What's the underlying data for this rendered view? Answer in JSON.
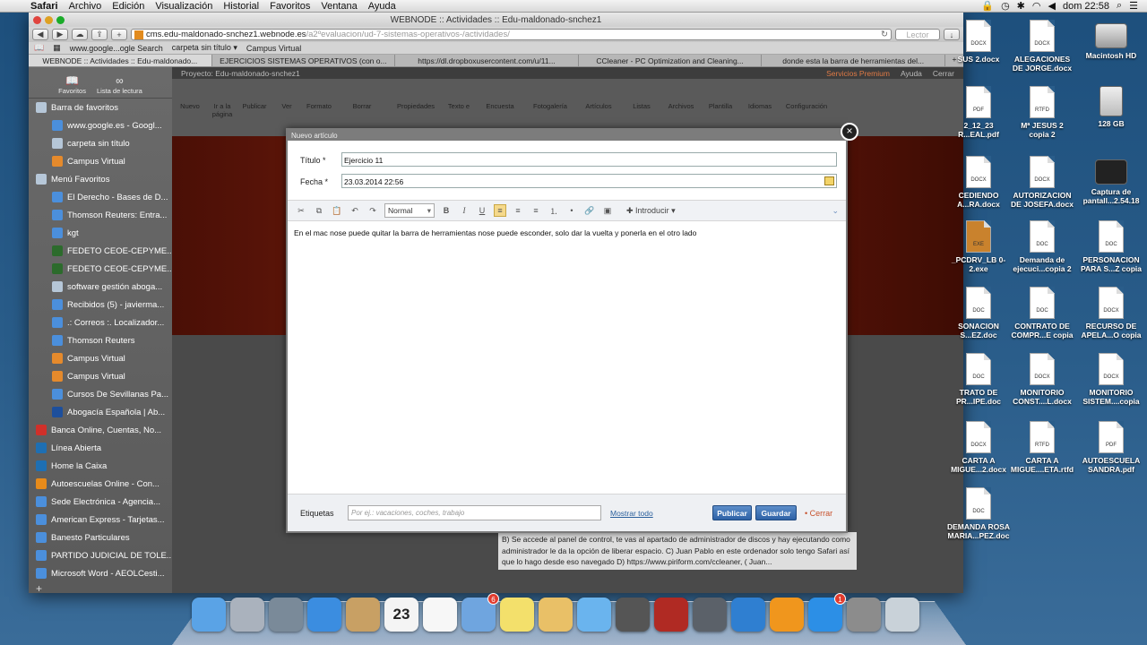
{
  "menubar": {
    "app": "Safari",
    "items": [
      "Archivo",
      "Edición",
      "Visualización",
      "Historial",
      "Favoritos",
      "Ventana",
      "Ayuda"
    ],
    "clock": "dom 22:58"
  },
  "window": {
    "title": "WEBNODE :: Actividades :: Edu-maldonado-snchez1",
    "address_domain": "cms.edu-maldonado-snchez1.webnode.es",
    "address_path": "/a2ºevaluacion/ud-7-sistemas-operativos-/actividades/",
    "reader_label": "Lector"
  },
  "bookmarks_bar": [
    "www.google...ogle Search",
    "carpeta sin título ▾",
    "Campus Virtual"
  ],
  "tabs": [
    "WEBNODE :: Actividades :: Edu-maldonado...",
    "EJERCICIOS SISTEMAS OPERATIVOS (con o...",
    "https://dl.dropboxusercontent.com/u/11...",
    "CCleaner - PC Optimization and Cleaning...",
    "donde esta la barra de herramientas del..."
  ],
  "sidebar": {
    "tab_favorites": "Favoritos",
    "tab_reading": "Lista de lectura",
    "items": [
      {
        "label": "Barra de favoritos",
        "indent": false,
        "icon": "folder-icon"
      },
      {
        "label": "www.google.es - Googl...",
        "indent": true,
        "icon": "globe-icon"
      },
      {
        "label": "carpeta sin título",
        "indent": true,
        "icon": "folder-icon"
      },
      {
        "label": "Campus Virtual",
        "indent": true,
        "icon": "campus-icon"
      },
      {
        "label": "Menú Favoritos",
        "indent": false,
        "icon": "folder-icon"
      },
      {
        "label": "El Derecho - Bases de D...",
        "indent": true,
        "icon": "globe-icon"
      },
      {
        "label": "Thomson Reuters: Entra...",
        "indent": true,
        "icon": "globe-icon"
      },
      {
        "label": "kgt",
        "indent": true,
        "icon": "globe-icon"
      },
      {
        "label": "FEDETO CEOE-CEPYME...",
        "indent": true,
        "icon": "fedeto-icon"
      },
      {
        "label": "FEDETO CEOE-CEPYME...",
        "indent": true,
        "icon": "fedeto-icon"
      },
      {
        "label": "software gestión aboga...",
        "indent": true,
        "icon": "folder-icon"
      },
      {
        "label": "Recibidos (5) - javierma...",
        "indent": true,
        "icon": "globe-icon"
      },
      {
        "label": ".: Correos :. Localizador...",
        "indent": true,
        "icon": "globe-icon"
      },
      {
        "label": "Thomson Reuters",
        "indent": true,
        "icon": "globe-icon"
      },
      {
        "label": "Campus Virtual",
        "indent": true,
        "icon": "campus-icon"
      },
      {
        "label": "Campus Virtual",
        "indent": true,
        "icon": "campus-icon"
      },
      {
        "label": "Cursos De Sevillanas Pa...",
        "indent": true,
        "icon": "globe-icon"
      },
      {
        "label": "Abogacía Española | Ab...",
        "indent": true,
        "icon": "abogacia-icon"
      },
      {
        "label": "Banca Online, Cuentas, No...",
        "indent": false,
        "icon": "bank-icon"
      },
      {
        "label": "Línea Abierta",
        "indent": false,
        "icon": "caixa-icon"
      },
      {
        "label": "Home  la Caixa",
        "indent": false,
        "icon": "caixa-icon"
      },
      {
        "label": "Autoescuelas Online - Con...",
        "indent": false,
        "icon": "autoescuela-icon"
      },
      {
        "label": "Sede Electrónica - Agencia...",
        "indent": false,
        "icon": "globe-icon"
      },
      {
        "label": "American Express - Tarjetas...",
        "indent": false,
        "icon": "globe-icon"
      },
      {
        "label": "Banesto Particulares",
        "indent": false,
        "icon": "globe-icon"
      },
      {
        "label": "PARTIDO JUDICIAL DE TOLE...",
        "indent": false,
        "icon": "globe-icon"
      },
      {
        "label": "Microsoft Word - AEOLCesti...",
        "indent": false,
        "icon": "globe-icon"
      }
    ]
  },
  "cms": {
    "project": "Proyecto: Edu-maldonado-snchez1",
    "premium": "Servicios Premium",
    "help": "Ayuda",
    "close": "Cerrar",
    "groups": [
      "Elementos",
      "Página",
      "Contenidos",
      "Varios"
    ],
    "ribbon": [
      "Nuevo",
      "Ir a la página",
      "Publicar",
      "Ver",
      "Formato",
      "Borrar",
      "Propiedades",
      "Texto e",
      "Encuesta",
      "Fotogalería",
      "Artículos",
      "Listas",
      "Archivos",
      "Plantilla",
      "Idiomas",
      "Configuración"
    ],
    "page_text": "B) Se accede al panel de control, te vas al apartado de administrador de discos y hay ejecutando como administrador le da la opción de liberar espacio.   C) Juan Pablo en este ordenador solo tengo Safari así que lo hago desde eso navegado D) https://www.piriform.com/ccleaner, ( Juan..."
  },
  "modal": {
    "title": "Nuevo artículo",
    "title_label": "Título *",
    "title_value": "Ejercicio 11",
    "date_label": "Fecha *",
    "date_value": "23.03.2014 22:56",
    "format_select": "Normal",
    "insert_label": "Introducir",
    "body": "En el mac nose puede quitar la barra de herramientas nose puede esconder, solo dar la vuelta y ponerla en el otro lado",
    "tags_label": "Etiquetas",
    "tags_placeholder": "Por ej.: vacaciones, coches, trabajo",
    "show_all": "Mostrar todo",
    "publish": "Publicar",
    "save": "Guardar",
    "cancel": "Cerrar"
  },
  "desktop_icons": [
    {
      "label": "SUS 2.docx",
      "kind": "DOCX"
    },
    {
      "label": "ALEGACIONES DE JORGE.docx",
      "kind": "DOCX"
    },
    {
      "label": "Macintosh HD",
      "kind": "hd"
    },
    {
      "label": "2_12_23 R...EAL.pdf",
      "kind": "PDF"
    },
    {
      "label": "Mª JESUS 2 copia 2",
      "kind": "RTFD"
    },
    {
      "label": "128 GB",
      "kind": "sd"
    },
    {
      "label": "CEDIENDO A...RA.docx",
      "kind": "DOCX"
    },
    {
      "label": "AUTORIZACION DE JOSEFA.docx",
      "kind": "DOCX"
    },
    {
      "label": "Captura de pantall...2.54.18",
      "kind": "img"
    },
    {
      "label": "_PCDRV_LB 0-2.exe",
      "kind": "EXE"
    },
    {
      "label": "Demanda de ejecuci...copia 2",
      "kind": "DOC"
    },
    {
      "label": "PERSONACION PARA S...Z copia",
      "kind": "DOC"
    },
    {
      "label": "SONACION S...EZ.doc",
      "kind": "DOC"
    },
    {
      "label": "CONTRATO DE COMPR...E copia",
      "kind": "DOC"
    },
    {
      "label": "RECURSO DE APELA...O copia",
      "kind": "DOCX"
    },
    {
      "label": "TRATO DE PR...IPE.doc",
      "kind": "DOC"
    },
    {
      "label": "MONITORIO CONST....L.docx",
      "kind": "DOCX"
    },
    {
      "label": "MONITORIO SISTEM....copia",
      "kind": "DOCX"
    },
    {
      "label": "CARTA A MIGUE...2.docx",
      "kind": "DOCX"
    },
    {
      "label": "CARTA A MIGUE....ETA.rtfd",
      "kind": "RTFD"
    },
    {
      "label": "AUTOESCUELA SANDRA.pdf",
      "kind": "PDF"
    },
    {
      "label": "DEMANDA ROSA MARIA...PEZ.doc",
      "kind": "DOC"
    }
  ],
  "dock": {
    "calendar_day": "23",
    "mail_badge": "6",
    "appstore_badge": "1",
    "apps": [
      "finder-icon",
      "launchpad-icon",
      "preview-icon",
      "safari-icon",
      "contacts-icon",
      "calendar-icon",
      "reminders-icon",
      "mail-icon",
      "notes-icon",
      "photos-icon",
      "messages-icon",
      "facetime-icon",
      "photobooth-icon",
      "image-capture-icon",
      "itunes-icon",
      "ibooks-icon",
      "appstore-icon",
      "system-preferences-icon",
      "trash-icon"
    ]
  }
}
